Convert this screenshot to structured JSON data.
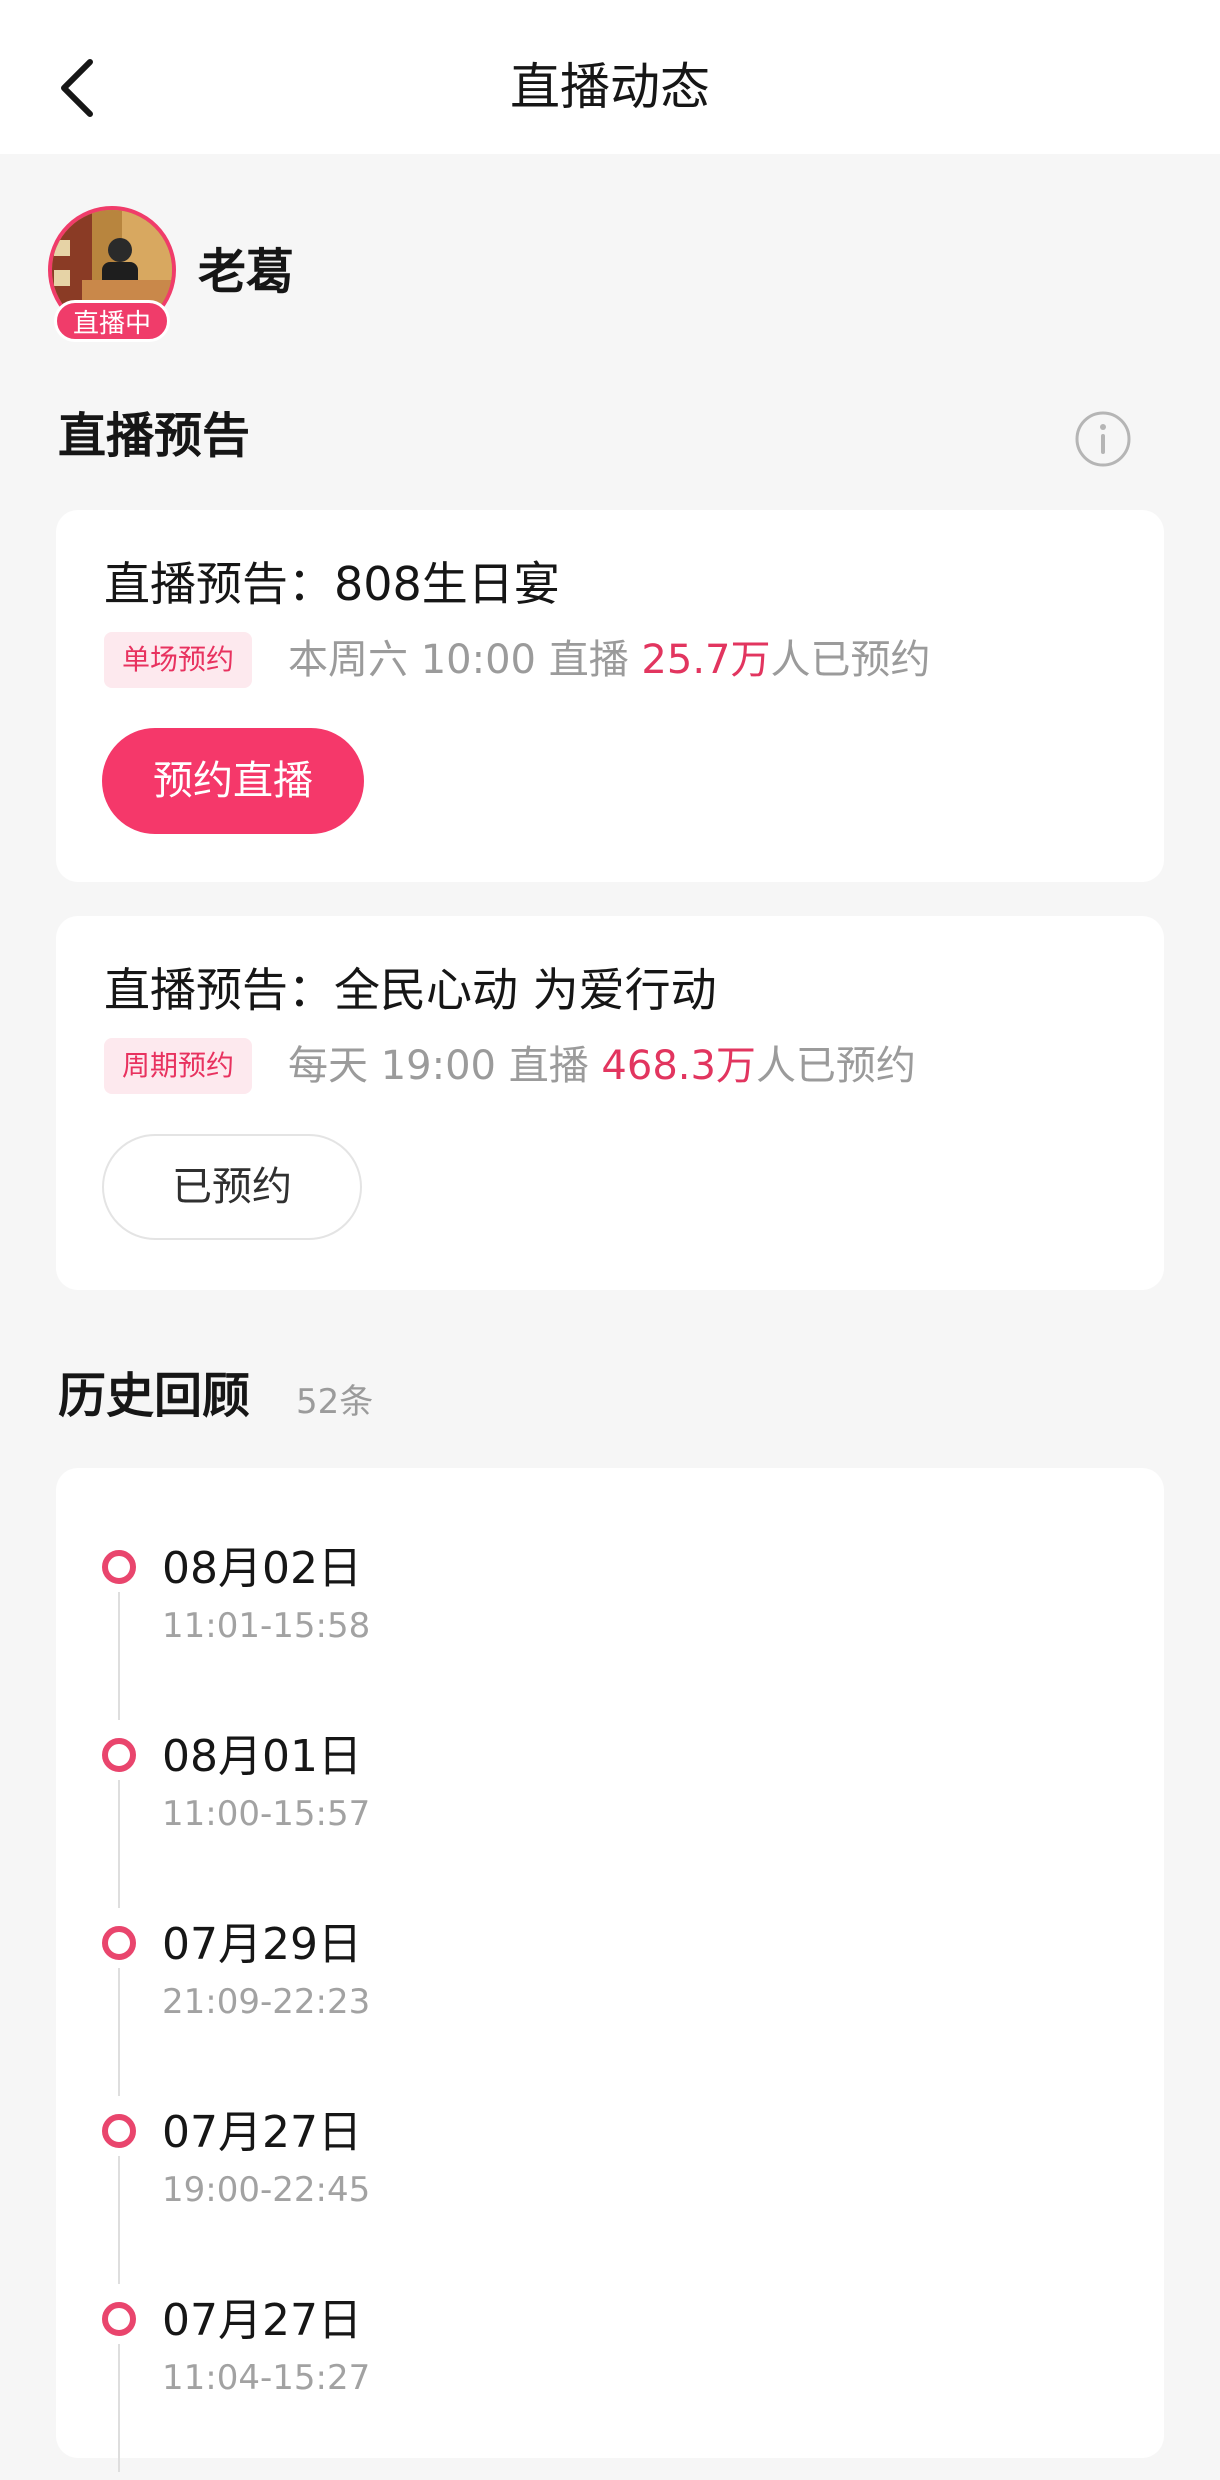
{
  "header": {
    "title": "直播动态"
  },
  "profile": {
    "name": "老葛",
    "live_badge": "直播中"
  },
  "preview_section": {
    "title": "直播预告"
  },
  "previews": [
    {
      "title": "直播预告：808生日宴",
      "tag": "单场预约",
      "schedule": "本周六 10:00 直播",
      "count": "25.7万",
      "count_suffix": "人已预约",
      "button": "预约直播"
    },
    {
      "title": "直播预告：全民心动 为爱行动",
      "tag": "周期预约",
      "schedule": "每天 19:00 直播",
      "count": "468.3万",
      "count_suffix": "人已预约",
      "button": "已预约"
    }
  ],
  "history": {
    "title": "历史回顾",
    "count": "52条",
    "items": [
      {
        "date": "08月02日",
        "time": "11:01-15:58"
      },
      {
        "date": "08月01日",
        "time": "11:00-15:57"
      },
      {
        "date": "07月29日",
        "time": "21:09-22:23"
      },
      {
        "date": "07月27日",
        "time": "19:00-22:45"
      },
      {
        "date": "07月27日",
        "time": "11:04-15:27"
      }
    ]
  },
  "colors": {
    "accent": "#f5386a",
    "tag_bg": "#fde9ee",
    "tag_text": "#e8325f",
    "muted": "#9b9b9b"
  },
  "icons": [
    "back-arrow-icon",
    "info-icon",
    "timeline-dot-icon"
  ]
}
